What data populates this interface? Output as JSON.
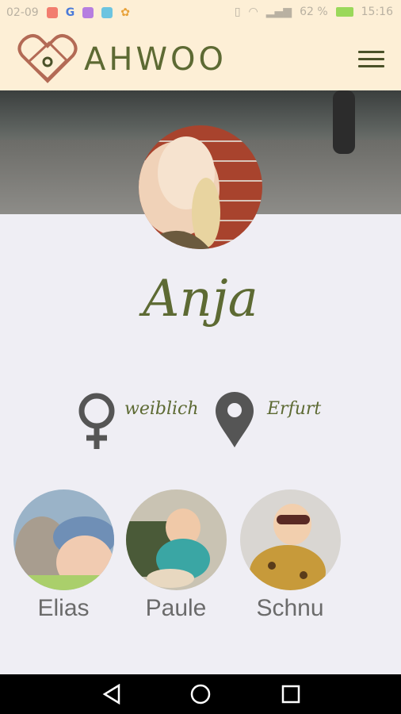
{
  "statusbar": {
    "time_left": "02-09",
    "battery": "62 %",
    "time": "15:16"
  },
  "app": {
    "brand": "AHWOO"
  },
  "profile": {
    "name": "Anja",
    "gender": "weiblich",
    "location": "Erfurt"
  },
  "children": [
    {
      "name": "Elias"
    },
    {
      "name": "Paule"
    },
    {
      "name": "Schnu"
    }
  ],
  "colors": {
    "bar_bg": "#fdefd6",
    "accent_green": "#5d6a33",
    "logo_red": "#b36a55",
    "page_bg": "#efeef4"
  }
}
